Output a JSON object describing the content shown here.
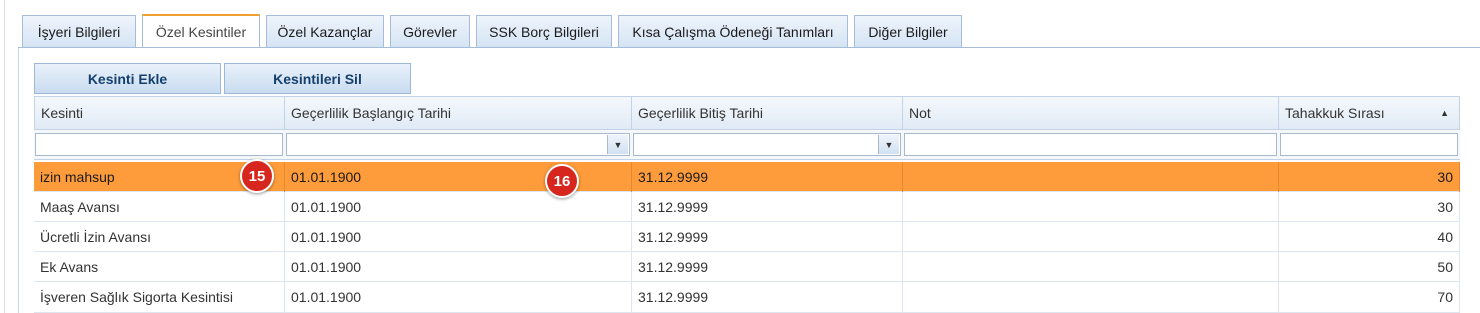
{
  "tabs": [
    {
      "label": "İşyeri Bilgileri"
    },
    {
      "label": "Özel Kesintiler"
    },
    {
      "label": "Özel Kazançlar"
    },
    {
      "label": "Görevler"
    },
    {
      "label": "SSK Borç Bilgileri"
    },
    {
      "label": "Kısa Çalışma Ödeneği Tanımları"
    },
    {
      "label": "Diğer Bilgiler"
    }
  ],
  "toolbar": {
    "add_label": "Kesinti Ekle",
    "delete_label": "Kesintileri Sil"
  },
  "grid": {
    "columns": [
      "Kesinti",
      "Geçerlilik Başlangıç Tarihi",
      "Geçerlilik Bitiş Tarihi",
      "Not",
      "Tahakkuk Sırası"
    ],
    "sort_indicator": "▲",
    "dropdown_glyph": "▼",
    "rows": [
      {
        "kesinti": "izin mahsup",
        "baslangic": "01.01.1900",
        "bitis": "31.12.9999",
        "not": "",
        "sira": "30"
      },
      {
        "kesinti": "Maaş Avansı",
        "baslangic": "01.01.1900",
        "bitis": "31.12.9999",
        "not": "",
        "sira": "30"
      },
      {
        "kesinti": "Ücretli İzin Avansı",
        "baslangic": "01.01.1900",
        "bitis": "31.12.9999",
        "not": "",
        "sira": "40"
      },
      {
        "kesinti": "Ek Avans",
        "baslangic": "01.01.1900",
        "bitis": "31.12.9999",
        "not": "",
        "sira": "50"
      },
      {
        "kesinti": "İşveren Sağlık Sigorta Kesintisi",
        "baslangic": "01.01.1900",
        "bitis": "31.12.9999",
        "not": "",
        "sira": "70"
      }
    ]
  },
  "badges": [
    "15",
    "16"
  ],
  "colors": {
    "selected_row": "#fe9c3c",
    "active_tab_accent": "#f0a030",
    "badge": "#d7261e"
  }
}
